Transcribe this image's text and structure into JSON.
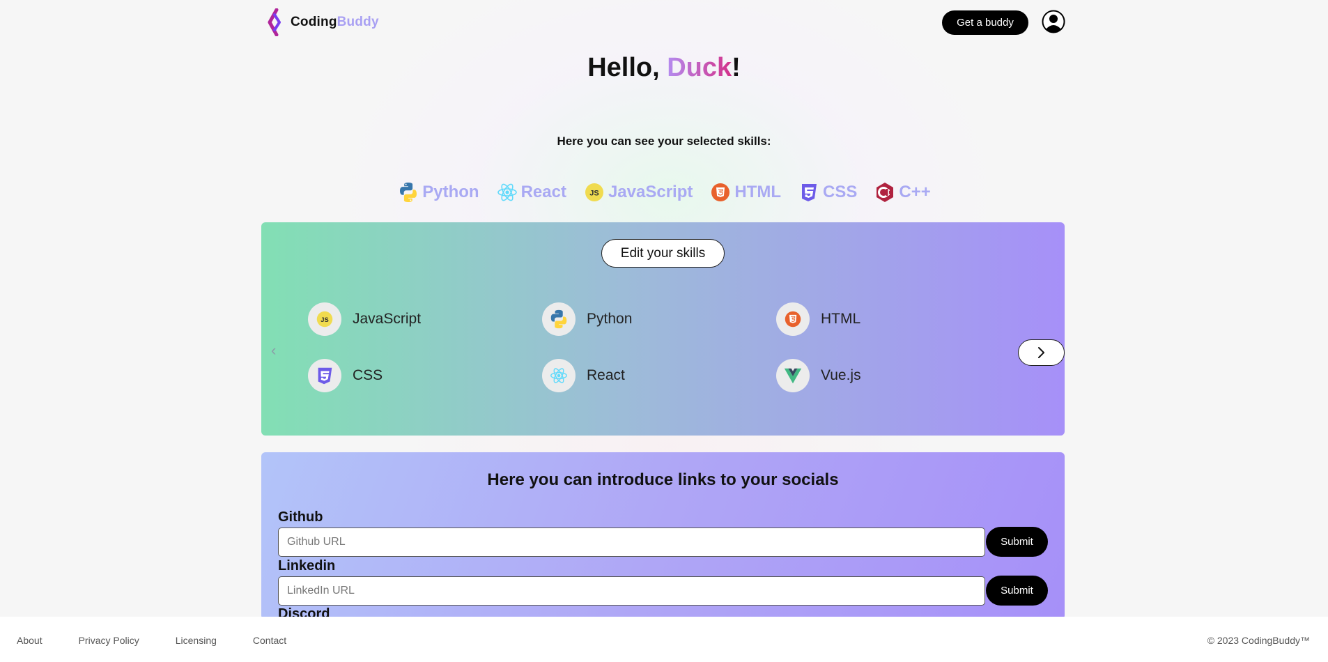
{
  "header": {
    "logo_part1": "Coding",
    "logo_part2": "Buddy",
    "get_buddy_label": "Get a buddy",
    "avatar_icon": "user-circle-icon"
  },
  "greeting": {
    "hello": "Hello, ",
    "name": "Duck",
    "exclaim": "!"
  },
  "selected_skills": {
    "title": "Here you can see your selected skills:",
    "items": [
      {
        "label": "Python",
        "icon": "python-icon"
      },
      {
        "label": "React",
        "icon": "react-icon"
      },
      {
        "label": "JavaScript",
        "icon": "javascript-icon"
      },
      {
        "label": "HTML",
        "icon": "html-icon"
      },
      {
        "label": "CSS",
        "icon": "css-icon"
      },
      {
        "label": "C++",
        "icon": "cpp-icon"
      }
    ]
  },
  "skills_panel": {
    "edit_label": "Edit your skills",
    "items": [
      {
        "label": "JavaScript",
        "icon": "javascript-icon"
      },
      {
        "label": "Python",
        "icon": "python-icon"
      },
      {
        "label": "HTML",
        "icon": "html-icon"
      },
      {
        "label": "CSS",
        "icon": "css-icon"
      },
      {
        "label": "React",
        "icon": "react-icon"
      },
      {
        "label": "Vue.js",
        "icon": "vue-icon"
      }
    ],
    "prev_icon": "chevron-left-icon",
    "next_icon": "chevron-right-icon"
  },
  "socials": {
    "title": "Here you can introduce links to your socials",
    "github": {
      "label": "Github",
      "placeholder": "Github URL",
      "submit": "Submit"
    },
    "linkedin": {
      "label": "Linkedin",
      "placeholder": "LinkedIn URL",
      "submit": "Submit"
    },
    "discord": {
      "label": "Discord"
    }
  },
  "footer": {
    "links": [
      "About",
      "Privacy Policy",
      "Licensing",
      "Contact"
    ],
    "copyright": "© 2023 CodingBuddy™"
  },
  "colors": {
    "brand_purple": "#a9a0f3",
    "name_gradient_start": "#b48cf0",
    "name_gradient_end": "#d3318a",
    "panel_green": "#82dfb4",
    "panel_purple": "#a690f8"
  }
}
